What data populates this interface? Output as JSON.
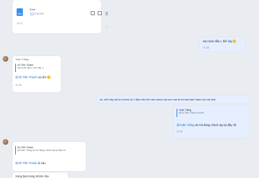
{
  "file_message": {
    "file_type": "TXT",
    "file_name": "5.txt",
    "file_size": "5.58 KB",
    "time": "11:27"
  },
  "outgoing_1": {
    "text": "sao toàn đầu L thế này",
    "time": "11:28"
  },
  "incoming_1": {
    "sender": "Tuấn Trắng",
    "quote_name": "Vũ Tiến Thành",
    "quote_text": "sao toàn đầu L thế này :x",
    "mention": "@Vũ Tiến Thành",
    "text": " ưa đời",
    "time": "11:28"
  },
  "outgoing_2": {
    "text": "ok, chỗ này mk ko check dc 2 đầu nên khi nào check via con nào bị mi báo bảo hành cho mk nhé"
  },
  "outgoing_3": {
    "quote_name": "Tuấn Trắng",
    "quote_text": "@Vũ Tiến Thành ưa đời",
    "mention": "@Tuấn Trắng",
    "text": " ok mk đang check tay lại đây rồi",
    "time": "11:41"
  },
  "incoming_2": {
    "quote_name": "Vũ Tiến Thành",
    "quote_text": "@Tuấn Trắng ok mk đang check tay lại đây rồi",
    "mention": "@Vũ Tiến Thành",
    "text": " ôi cậu"
  },
  "incoming_3": {
    "text": "Xong báo trong nhóm nha"
  },
  "colors": {
    "background": "#e9ecf1",
    "incoming_bubble": "#ffffff",
    "outgoing_bubble": "#e5efff",
    "mention": "#1a6fd6",
    "quote_bar": "#2f7be5"
  },
  "icons": [
    "cloud-icon",
    "share-icon",
    "copy-icon",
    "download-icon",
    "heart-icon",
    "emoji-icon"
  ]
}
